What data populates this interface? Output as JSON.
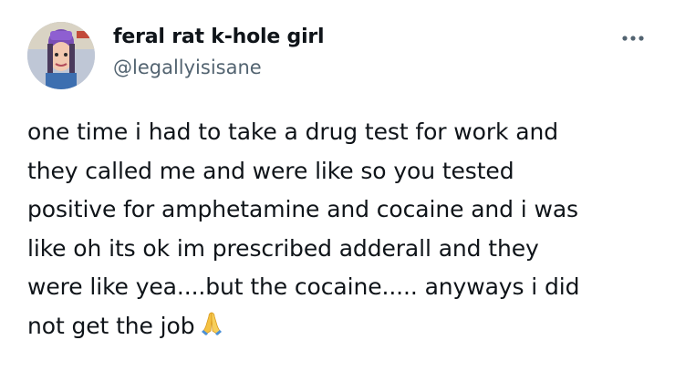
{
  "tweet": {
    "author": {
      "display_name": "feral rat k-hole girl",
      "handle": "@legallyisisane",
      "avatar_icon": "cartoon-girl-avatar"
    },
    "more_icon": "more-horizontal-icon",
    "text": "one time i had to take a drug test for work and\nthey called me and were like so you tested\npositive for amphetamine and cocaine and i was\nlike oh its ok im prescribed adderall and they\nwere like yea....but the cocaine..... anyways i did\nnot get the job",
    "emoji_icon": "folded-hands-icon",
    "colors": {
      "text": "#0f1419",
      "secondary": "#536471",
      "background": "#ffffff"
    }
  }
}
